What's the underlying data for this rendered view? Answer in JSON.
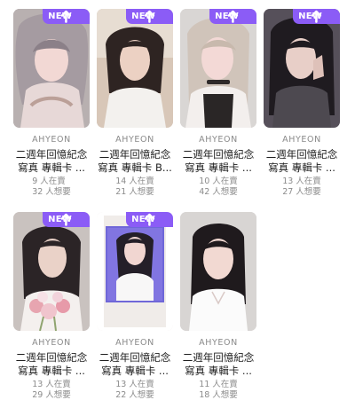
{
  "badge": {
    "label": "NEW",
    "icon": "arrow-up-icon",
    "color": "#8b5cf6"
  },
  "products": [
    {
      "artist": "AHYEON",
      "title": "二週年回憶紀念\n寫真 專輯卡 ...",
      "sellers": "9 人在賣",
      "wanters": "32 人想要",
      "image": "portrait-silver-hair"
    },
    {
      "artist": "AHYEON",
      "title": "二週年回憶紀念\n寫真 專輯卡 B...",
      "sellers": "14 人在賣",
      "wanters": "21 人想要",
      "image": "portrait-dark-hair-indoor"
    },
    {
      "artist": "AHYEON",
      "title": "二週年回憶紀念\n寫真 專輯卡 ...",
      "sellers": "10 人在賣",
      "wanters": "42 人想要",
      "image": "portrait-blonde-choker"
    },
    {
      "artist": "AHYEON",
      "title": "二週年回憶紀念\n寫真 專輯卡 ...",
      "sellers": "13 人在賣",
      "wanters": "27 人想要",
      "image": "portrait-dark-hair-hand"
    },
    {
      "artist": "AHYEON",
      "title": "二週年回憶紀念\n寫真 專輯卡 ...",
      "sellers": "13 人在賣",
      "wanters": "29 人想要",
      "image": "portrait-flowers"
    },
    {
      "artist": "AHYEON",
      "title": "二週年回憶紀念\n寫真 專輯卡 ...",
      "sellers": "13 人在賣",
      "wanters": "22 人想要",
      "image": "portrait-polaroid"
    },
    {
      "artist": "AHYEON",
      "title": "二週年回憶紀念\n寫真 專輯卡 ...",
      "sellers": "11 人在賣",
      "wanters": "18 人想要",
      "image": "portrait-white-top"
    }
  ]
}
